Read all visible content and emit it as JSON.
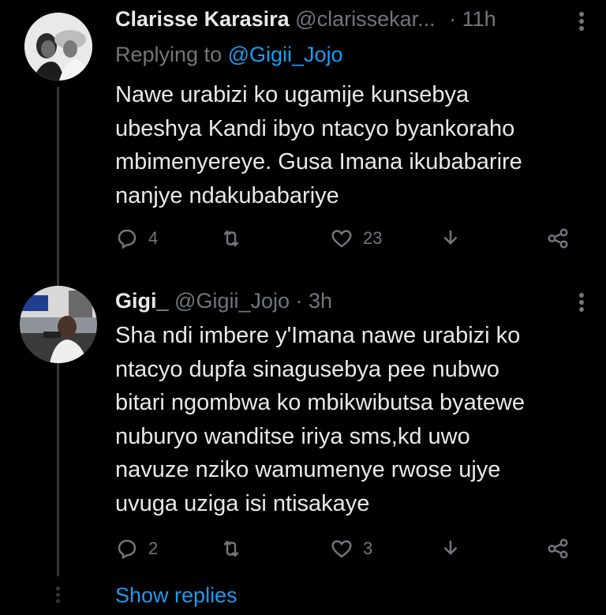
{
  "tweets": [
    {
      "display_name": "Clarisse Karasira",
      "handle": "@clarissekar...",
      "separator": "·",
      "time": "11h",
      "replying_prefix": "Replying to",
      "replying_to": "@Gigii_Jojo",
      "text": "Nawe urabizi ko ugamije kunsebya\nubeshya Kandi ibyo ntacyo byankoraho\nmbimenyereye. Gusa Imana ikubabarire\nnanjye ndakubabariye",
      "reply_count": "4",
      "retweet_count": "",
      "like_count": "23"
    },
    {
      "display_name": "Gigi_",
      "handle": "@Gigii_Jojo",
      "separator": "·",
      "time": "3h",
      "text": "Sha ndi imbere y'Imana nawe urabizi ko\nntacyo dupfa sinagusebya pee nubwo\nbitari ngombwa ko mbikwibutsa byatewe\nnuburyo wanditse iriya sms,kd uwo\nnavuze nziko wamumenye rwose ujye\nuvuga uziga isi ntisakaye",
      "reply_count": "2",
      "retweet_count": "",
      "like_count": "3"
    }
  ],
  "show_replies_label": "Show replies",
  "colors": {
    "background": "#000000",
    "text": "#e7e9ea",
    "muted": "#71767b",
    "accent": "#1d9bf0",
    "line": "#333639"
  },
  "icons": [
    "reply-icon",
    "retweet-icon",
    "like-icon",
    "share-download-icon",
    "share-icon",
    "more-icon"
  ]
}
